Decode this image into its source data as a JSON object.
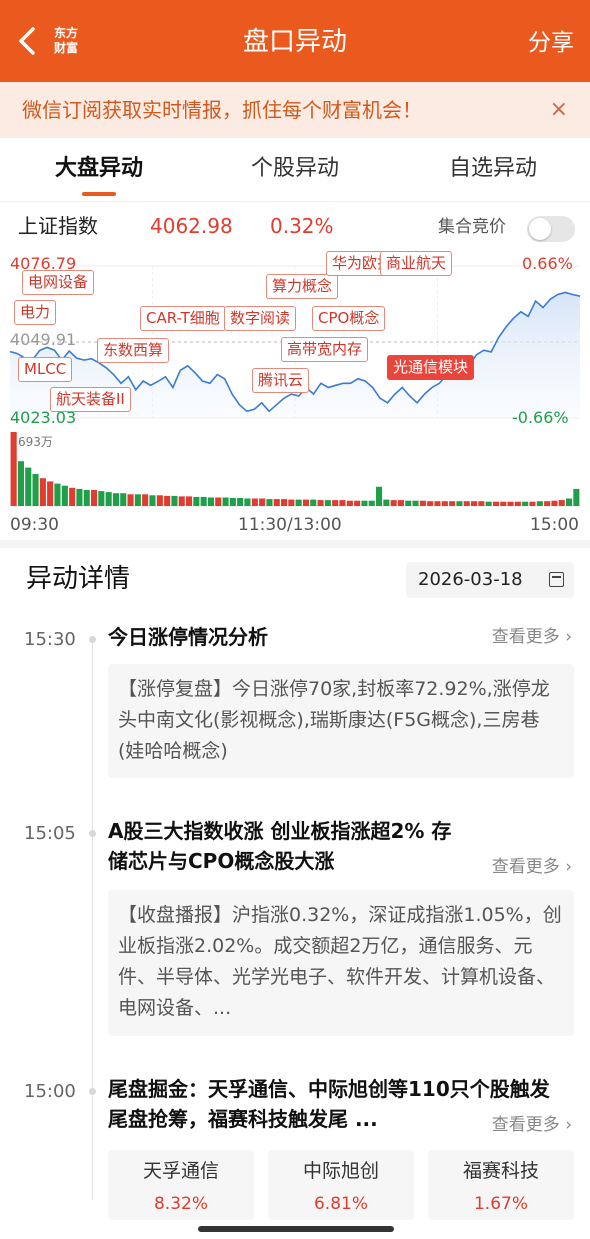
{
  "topbar": {
    "title": "盘口异动",
    "logo_line1": "东方",
    "logo_line2": "财富",
    "share": "分享"
  },
  "banner": {
    "text": "微信订阅获取实时情报，抓住每个财富机会！",
    "close": "×"
  },
  "tabs": [
    {
      "label": "大盘异动",
      "active": true
    },
    {
      "label": "个股异动",
      "active": false
    },
    {
      "label": "自选异动",
      "active": false
    }
  ],
  "index": {
    "name": "上证指数",
    "value": "4062.98",
    "change_pct": "0.32%",
    "auction_label": "集合竞价",
    "auction_toggle_on": false
  },
  "chart_data": {
    "type": "line",
    "title": "",
    "xlabel": "",
    "ylabel": "",
    "ylim": [
      4023.03,
      4076.79
    ],
    "y_top_label": "4076.79",
    "y_mid_label": "4049.91",
    "y_bottom_label": "4023.03",
    "pct_top_label": "0.66%",
    "pct_bottom_label": "-0.66%",
    "volume_max_label": "693万",
    "x_labels": [
      "09:30",
      "11:30/13:00",
      "15:00"
    ],
    "price_series": [
      4046.5,
      4045.8,
      4044.2,
      4043.5,
      4046.9,
      4048.0,
      4047.0,
      4043.5,
      4046.7,
      4044.2,
      4043.5,
      4044.0,
      4042.6,
      4040.8,
      4038.4,
      4035.3,
      4037.6,
      4033.0,
      4036.1,
      4034.6,
      4036.0,
      4037.6,
      4033.8,
      4039.9,
      4041.5,
      4039.0,
      4036.1,
      4035.3,
      4038.4,
      4036.9,
      4031.5,
      4027.7,
      4025.4,
      4026.1,
      4028.4,
      4025.4,
      4027.7,
      4030.0,
      4031.5,
      4030.8,
      4033.8,
      4031.5,
      4035.3,
      4033.8,
      4034.6,
      4035.3,
      4035.3,
      4036.9,
      4036.1,
      4033.8,
      4030.0,
      4028.4,
      4031.5,
      4033.8,
      4030.8,
      4028.4,
      4031.5,
      4033.8,
      4035.3,
      4038.4,
      4040.8,
      4040.1,
      4041.5,
      4045.4,
      4047.0,
      4046.4,
      4051.5,
      4055.2,
      4058.3,
      4060.6,
      4059.0,
      4064.4,
      4062.1,
      4065.1,
      4066.7,
      4067.4,
      4066.7,
      4066.1
    ],
    "volume_series": [
      693,
      420,
      360,
      300,
      260,
      230,
      210,
      190,
      170,
      160,
      150,
      150,
      140,
      130,
      120,
      120,
      110,
      110,
      110,
      100,
      100,
      95,
      95,
      90,
      90,
      85,
      85,
      80,
      80,
      80,
      75,
      75,
      70,
      70,
      70,
      65,
      65,
      65,
      60,
      60,
      60,
      60,
      55,
      55,
      55,
      55,
      50,
      50,
      50,
      50,
      180,
      60,
      55,
      55,
      50,
      50,
      50,
      45,
      45,
      45,
      45,
      45,
      45,
      45,
      45,
      40,
      40,
      40,
      40,
      40,
      40,
      40,
      45,
      45,
      50,
      55,
      70,
      160
    ],
    "tags": [
      {
        "label": "电网设备",
        "filled": false
      },
      {
        "label": "电力",
        "filled": false
      },
      {
        "label": "MLCC",
        "filled": false
      },
      {
        "label": "东数西算",
        "filled": false
      },
      {
        "label": "航天装备II",
        "filled": false
      },
      {
        "label": "CAR-T细胞",
        "filled": false
      },
      {
        "label": "数字阅读",
        "filled": false
      },
      {
        "label": "算力概念",
        "filled": false
      },
      {
        "label": "华为欧拉",
        "filled": false
      },
      {
        "label": "商业航天",
        "filled": false
      },
      {
        "label": "CPO概念",
        "filled": false
      },
      {
        "label": "高带宽内存",
        "filled": false
      },
      {
        "label": "腾讯云",
        "filled": false
      },
      {
        "label": "光通信模块",
        "filled": true
      }
    ]
  },
  "details": {
    "title": "异动详情",
    "date": "2026-03-18",
    "more_label": "查看更多",
    "events": [
      {
        "time": "15:30",
        "title": "今日涨停情况分析",
        "body": "【涨停复盘】今日涨停70家,封板率72.92%,涨停龙头中南文化(影视概念),瑞斯康达(F5G概念),三房巷(娃哈哈概念)"
      },
      {
        "time": "15:05",
        "title": "A股三大指数收涨 创业板指涨超2% 存储芯片与CPO概念股大涨",
        "body": "【收盘播报】沪指涨0.32%，深证成指涨1.05%，创业板指涨2.02%。成交额超2万亿，通信服务、元件、半导体、光学光电子、软件开发、计算机设备、电网设备、..."
      },
      {
        "time": "15:00",
        "title": "尾盘掘金：天孚通信、中际旭创等110只个股触发尾盘抢筹，福赛科技触发尾 ...",
        "stocks": [
          {
            "name": "天孚通信",
            "pct": "8.32%"
          },
          {
            "name": "中际旭创",
            "pct": "6.81%"
          },
          {
            "name": "福赛科技",
            "pct": "1.67%"
          }
        ]
      }
    ]
  },
  "colors": {
    "brand": "#ea5a1e",
    "up": "#e03c2f",
    "down": "#1f9f4a",
    "line": "#3a7bd5"
  }
}
